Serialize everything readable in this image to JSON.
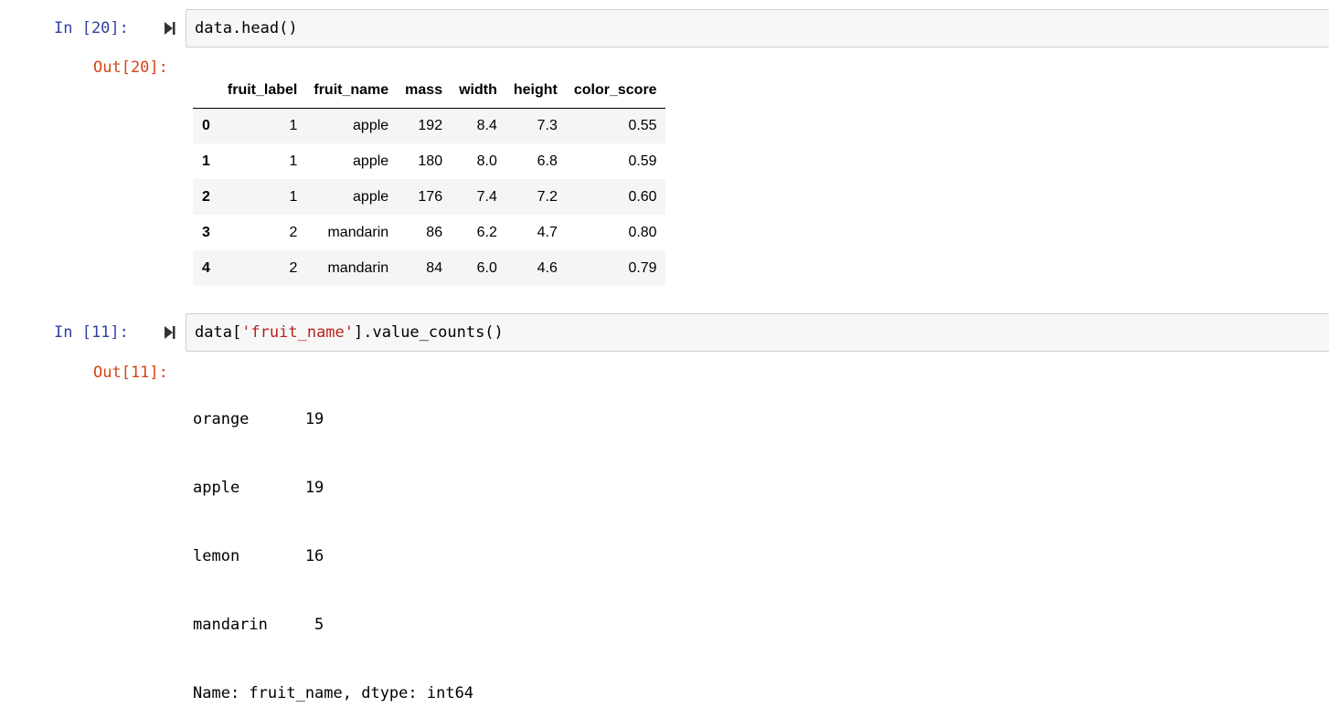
{
  "cells": [
    {
      "in_prompt": "In [20]:",
      "code": "data.head()",
      "out_prompt": "Out[20]:",
      "table": {
        "columns": [
          "",
          "fruit_label",
          "fruit_name",
          "mass",
          "width",
          "height",
          "color_score"
        ],
        "rows": [
          [
            "0",
            "1",
            "apple",
            "192",
            "8.4",
            "7.3",
            "0.55"
          ],
          [
            "1",
            "1",
            "apple",
            "180",
            "8.0",
            "6.8",
            "0.59"
          ],
          [
            "2",
            "1",
            "apple",
            "176",
            "7.4",
            "7.2",
            "0.60"
          ],
          [
            "3",
            "2",
            "mandarin",
            "86",
            "6.2",
            "4.7",
            "0.80"
          ],
          [
            "4",
            "2",
            "mandarin",
            "84",
            "6.0",
            "4.6",
            "0.79"
          ]
        ]
      }
    },
    {
      "in_prompt": "In [11]:",
      "code_prefix": "data[",
      "code_string": "'fruit_name'",
      "code_suffix": "].value_counts()",
      "out_prompt": "Out[11]:",
      "output_lines": [
        "orange      19",
        "apple       19",
        "lemon       16",
        "mandarin     5",
        "Name: fruit_name, dtype: int64"
      ]
    }
  ],
  "icons": {
    "run": "run-cell-icon"
  },
  "colors": {
    "in_prompt": "#303f9f",
    "out_prompt": "#d84315",
    "string": "#ba2121",
    "cell_bg": "#f7f7f7"
  }
}
